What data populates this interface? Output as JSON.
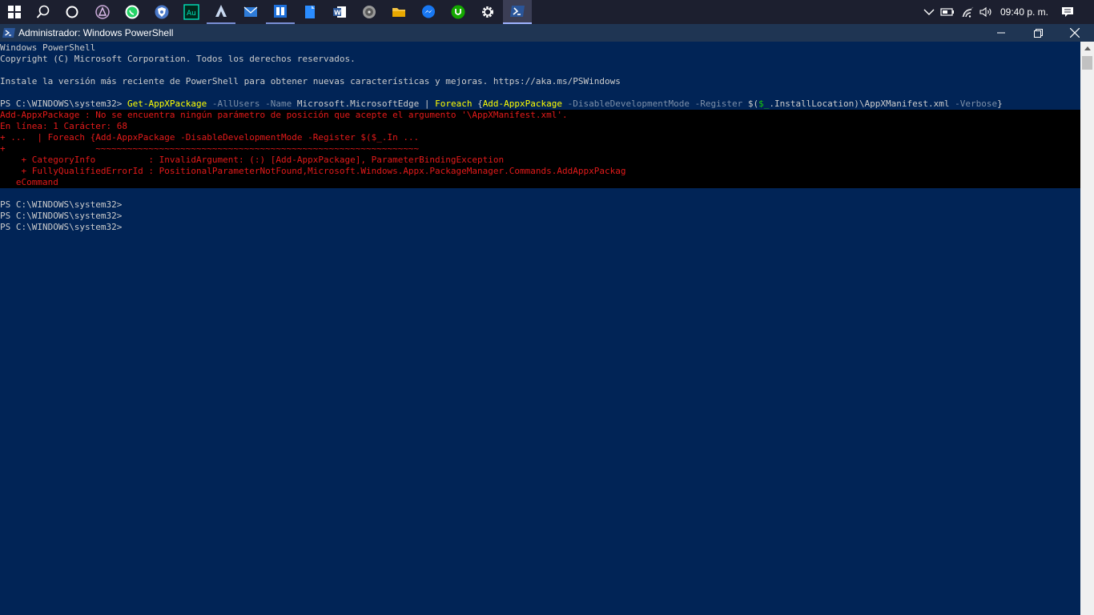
{
  "taskbar": {
    "icons": [
      {
        "name": "windows-start-icon"
      },
      {
        "name": "search-icon"
      },
      {
        "name": "cortana-icon"
      },
      {
        "name": "affinity-app-icon"
      },
      {
        "name": "whatsapp-icon"
      },
      {
        "name": "vpn-shield-icon"
      },
      {
        "name": "audition-icon"
      },
      {
        "name": "assassins-creed-icon"
      },
      {
        "name": "mail-icon"
      },
      {
        "name": "dolby-app-icon"
      },
      {
        "name": "note-app-icon"
      },
      {
        "name": "word-icon"
      },
      {
        "name": "disk-app-icon"
      },
      {
        "name": "file-explorer-icon"
      },
      {
        "name": "messenger-icon"
      },
      {
        "name": "upwork-icon"
      },
      {
        "name": "settings-gear-icon"
      },
      {
        "name": "powershell-taskbar-icon"
      }
    ],
    "tray": {
      "clock": "09:40 p. m."
    }
  },
  "window": {
    "title": "Administrador: Windows PowerShell"
  },
  "console": {
    "header1": "Windows PowerShell",
    "header2": "Copyright (C) Microsoft Corporation. Todos los derechos reservados.",
    "header3": "Instale la versión más reciente de PowerShell para obtener nuevas características y mejoras. https://aka.ms/PSWindows",
    "command": {
      "prompt": "PS C:\\WINDOWS\\system32> ",
      "t1": "Get-AppXPackage",
      "t2": " -AllUsers -Name ",
      "t3": "Microsoft.MicrosoftEdge | ",
      "t4": "Foreach ",
      "t5": "{",
      "t6": "Add-AppxPackage",
      "t7": " -DisableDevelopmentMode -Register ",
      "t8": "$(",
      "t9": "$_",
      "t10": ".InstallLocation)\\AppXManifest.xml",
      "t11": " -Verbose",
      "t12": "}"
    },
    "error": [
      "Add-AppxPackage : No se encuentra ningún parámetro de posición que acepte el argumento '\\AppXManifest.xml'.",
      "En línea: 1 Carácter: 68",
      "+ ...  | Foreach {Add-AppxPackage -DisableDevelopmentMode -Register $($_.In ...",
      "+                 ~~~~~~~~~~~~~~~~~~~~~~~~~~~~~~~~~~~~~~~~~~~~~~~~~~~~~~~~~~~~~",
      "    + CategoryInfo          : InvalidArgument: (:) [Add-AppxPackage], ParameterBindingException",
      "    + FullyQualifiedErrorId : PositionalParameterNotFound,Microsoft.Windows.Appx.PackageManager.Commands.AddAppxPackag",
      "   eCommand"
    ],
    "prompts": [
      "PS C:\\WINDOWS\\system32>",
      "PS C:\\WINDOWS\\system32>",
      "PS C:\\WINDOWS\\system32>"
    ]
  },
  "colors": {
    "console_bg": "#012456",
    "error_text": "#e41a1a",
    "cmdlet": "#ffff00",
    "parameter": "#7c8fa8",
    "variable": "#16c60c"
  }
}
